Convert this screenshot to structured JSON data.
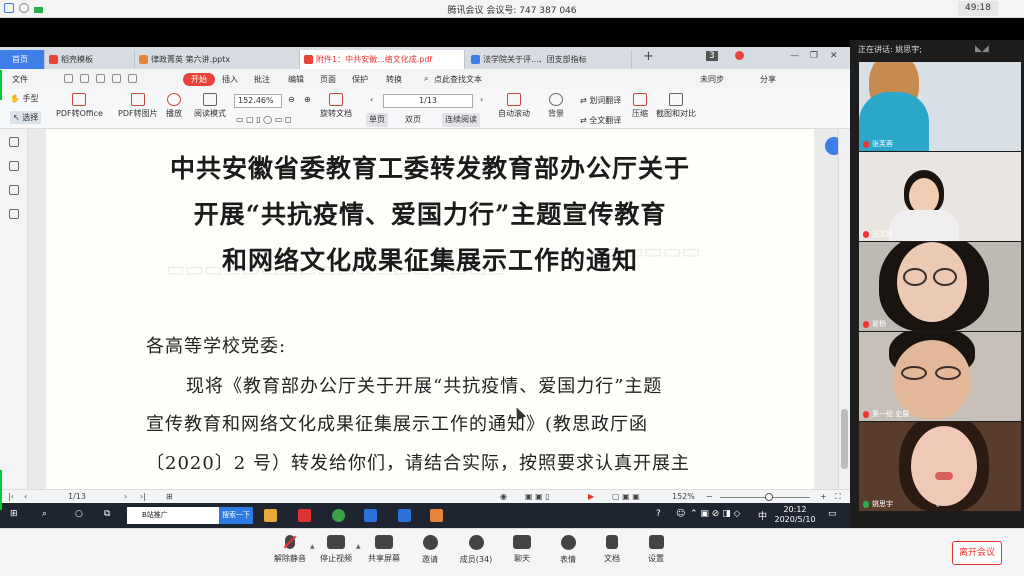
{
  "meeting": {
    "title": "腾讯会议 会议号: 747 387 046",
    "time": "49:18",
    "speaking_label": "正在讲话: 姚思宇;",
    "participants": [
      {
        "name": "张芙蓉"
      },
      {
        "name": "王文慧"
      },
      {
        "name": "翟杨"
      },
      {
        "name": "第一组 史展"
      },
      {
        "name": "姚思宇"
      }
    ],
    "toolbar": {
      "mute": "解除静音",
      "video": "停止视频",
      "share": "共享屏幕",
      "invite": "邀请",
      "members": "成员(34)",
      "chat": "聊天",
      "reactions": "表情",
      "docs": "文档",
      "settings": "设置",
      "leave": "离开会议"
    }
  },
  "wps": {
    "tabs": [
      {
        "label": "首页"
      },
      {
        "label": "稻壳模板"
      },
      {
        "label": "律政菁英 第六讲.pptx"
      },
      {
        "label": "附件1：中共安徽...络文化成.pdf"
      },
      {
        "label": "法学院关于评...、团支部指标"
      }
    ],
    "tab_count": "3",
    "menu": {
      "file": "文件",
      "start": "开始",
      "insert": "插入",
      "annotate": "批注",
      "edit": "编辑",
      "page": "页面",
      "protect": "保护",
      "convert": "转换",
      "search": "点此查找文本",
      "sync": "未同步",
      "share": "分享"
    },
    "ribbon": {
      "hand": "手型",
      "select": "选择",
      "pdf_to_office": "PDF转Office",
      "pdf_to_image": "PDF转图片",
      "play": "播放",
      "read_mode": "阅读模式",
      "zoom": "152.46%",
      "page": "1/13",
      "rotate": "旋转文档",
      "single": "单页",
      "double": "双页",
      "continuous": "连续阅读",
      "auto_scroll": "自动滚动",
      "background": "背景",
      "translate_word": "划词翻译",
      "translate_full": "全文翻译",
      "compress": "压缩",
      "screenshot": "截图和对比"
    },
    "status": {
      "page": "1/13",
      "zoom": "152%"
    }
  },
  "document": {
    "title_lines": [
      "中共安徽省委教育工委转发教育部办公厅关于",
      "开展“共抗疫情、爱国力行”主题宣传教育",
      "和网络文化成果征集展示工作的通知"
    ],
    "body_lines": [
      "各高等学校党委:",
      "现将《教育部办公厅关于开展“共抗疫情、爱国力行”主题",
      "宣传教育和网络文化成果征集展示工作的通知》(教思政厅函",
      "〔2020〕2 号）转发给你们，请结合实际，按照要求认真开展主"
    ]
  },
  "taskbar": {
    "search_text": "B站推广",
    "search_button": "搜索一下",
    "ime": "中",
    "time": "20:12",
    "date": "2020/5/10"
  }
}
